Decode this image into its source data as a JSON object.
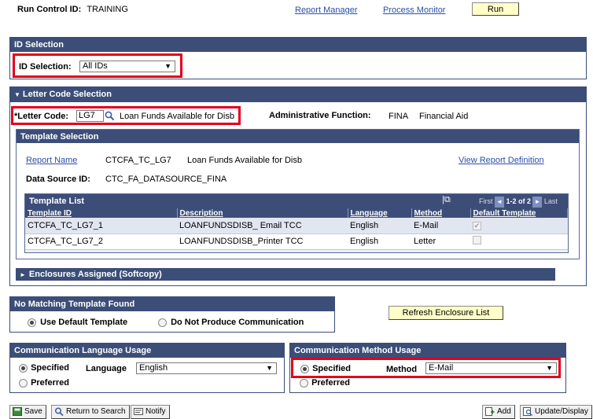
{
  "top": {
    "run_control_label": "Run Control ID:",
    "run_control_value": "TRAINING",
    "report_manager": "Report Manager",
    "process_monitor": "Process Monitor",
    "run_button": "Run"
  },
  "id_selection": {
    "header": "ID Selection",
    "label": "ID Selection:",
    "value": "All IDs"
  },
  "letter_code_selection": {
    "header": "Letter Code Selection",
    "letter_code_label": "*Letter Code:",
    "letter_code_value": "LG7",
    "letter_code_desc": "Loan Funds Available for Disb",
    "admin_function_label": "Administrative Function:",
    "admin_function_code": "FINA",
    "admin_function_desc": "Financial Aid"
  },
  "template_selection": {
    "header": "Template Selection",
    "report_name_link": "Report Name",
    "report_name_code": "CTCFA_TC_LG7",
    "report_name_desc": "Loan Funds Available for Disb",
    "view_report_definition": "View Report Definition",
    "data_source_label": "Data Source ID:",
    "data_source_value": "CTC_FA_DATASOURCE_FINA"
  },
  "template_list": {
    "header": "Template List",
    "nav_first": "First",
    "nav_range": "1-2 of 2",
    "nav_last": "Last",
    "columns": [
      "Template ID",
      "Description",
      "Language",
      "Method",
      "Default Template"
    ],
    "rows": [
      {
        "id": "CTCFA_TC_LG7_1",
        "description": "LOANFUNDSDISB_ Email TCC",
        "language": "English",
        "method": "E-Mail"
      },
      {
        "id": "CTCFA_TC_LG7_2",
        "description": "LOANFUNDSDISB_Printer TCC",
        "language": "English",
        "method": "Letter"
      }
    ]
  },
  "enclosures": {
    "header": "Enclosures Assigned (Softcopy)"
  },
  "no_match": {
    "header": "No Matching Template Found",
    "opt_default": "Use Default Template",
    "opt_none": "Do Not Produce Communication"
  },
  "refresh_button": "Refresh Enclosure List",
  "comm_language": {
    "header": "Communication Language Usage",
    "opt_specified": "Specified",
    "language_label": "Language",
    "language_value": "English",
    "opt_preferred": "Preferred"
  },
  "comm_method": {
    "header": "Communication Method Usage",
    "opt_specified": "Specified",
    "method_label": "Method",
    "method_value": "E-Mail",
    "opt_preferred": "Preferred"
  },
  "toolbar": {
    "save": "Save",
    "return_to_search": "Return to Search",
    "notify": "Notify",
    "add": "Add",
    "update_display": "Update/Display"
  }
}
